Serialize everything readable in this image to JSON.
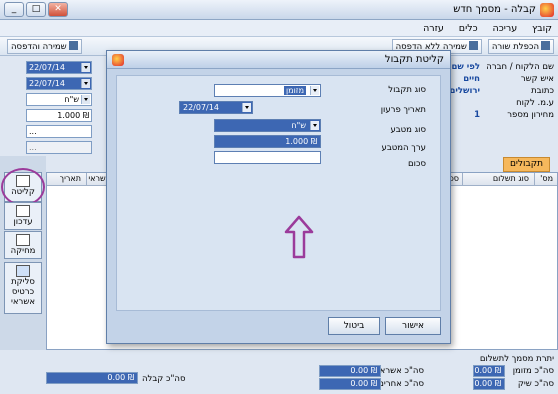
{
  "window": {
    "title": "קבלה - מסמך חדש"
  },
  "menu": [
    "קובץ",
    "עריכה",
    "כלים",
    "עזרה"
  ],
  "toolbar": {
    "save_print": "שמירה והדפסה",
    "save_no_print": "שמירה ללא הדפסה",
    "duplicate_row": "הכפלת שורה"
  },
  "header": {
    "labels": {
      "customer": "שם הלקוח / חברה",
      "contact": "איש קשר",
      "address": "כתובת",
      "vat_id": "ע.מ. לקוח",
      "pricelist": "מחירון מספר"
    },
    "values": {
      "customer": "לפי שם",
      "contact": "חיים",
      "address": "ירושלים",
      "pricelist": "1"
    },
    "fields": {
      "date1": "22/07/14",
      "date2": "22/07/14",
      "currency": "ש\"ח",
      "rate": "1.000 ₪",
      "more": "...",
      "more2": "..."
    }
  },
  "tab": {
    "label": "תקבולים"
  },
  "grid": {
    "columns": [
      "מס'",
      "סוג תשלום",
      "סכום",
      "אשראי",
      "תאריך"
    ]
  },
  "side_buttons": {
    "receive": "קליטה",
    "update": "עדכון",
    "delete": "מחיקה",
    "credit": [
      "סליקת",
      "כרטיס",
      "אשראי"
    ]
  },
  "dialog": {
    "title": "קליטת תקבול",
    "labels": {
      "payment_type": "סוג תקבול",
      "due_date": "תאריך פרעון",
      "currency_type": "סוג מטבע",
      "currency_value": "ערך המטבע",
      "amount": "סכום"
    },
    "fields": {
      "payment_type": "מזומן",
      "due_date": "22/07/14",
      "currency_type": "ש\"ח",
      "currency_value": "1.000 ₪",
      "amount": ""
    },
    "ok": "אישור",
    "cancel": "ביטול"
  },
  "footer": {
    "balance_label": "יתרת מסמך לתשלום",
    "cash_label": "סה\"כ מזומן",
    "credit_label": "סה\"כ אשראי",
    "check_label": "סה\"כ שיק",
    "other_label": "סה\"כ אחרים",
    "receipt_label": "סה\"כ קבלה",
    "cash": "0.00 ₪",
    "credit": "0.00 ₪",
    "check": "0.00 ₪",
    "other": "0.00 ₪",
    "receipt": "0.00 ₪",
    "extra1": "0.00 ₪",
    "extra2": "0.00 ₪"
  },
  "colors": {
    "accent": "#3d67b3",
    "tab": "#f6b85c",
    "annotation": "#9b3b9b"
  }
}
